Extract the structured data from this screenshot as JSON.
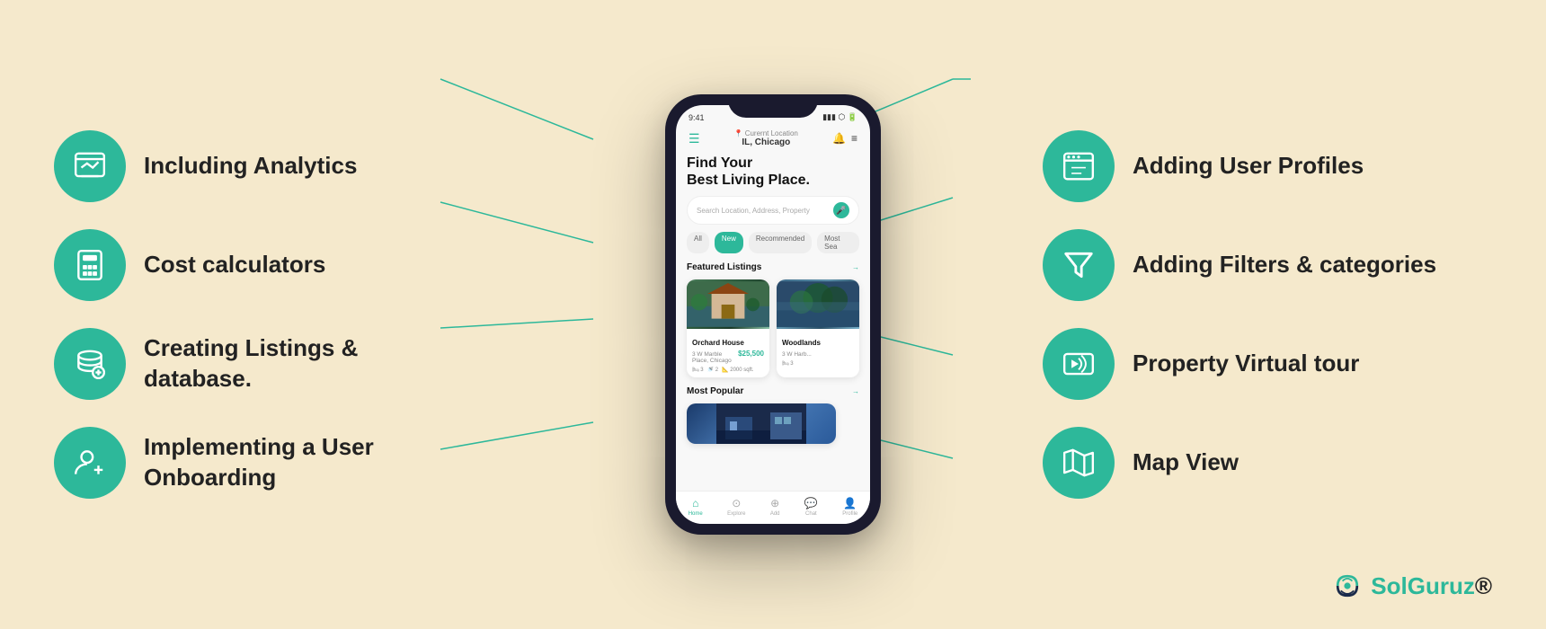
{
  "background_color": "#f5e9cc",
  "accent_color": "#2db89a",
  "left_features": [
    {
      "id": "analytics",
      "label": "Including Analytics",
      "icon": "analytics-icon"
    },
    {
      "id": "calculator",
      "label": "Cost calculators",
      "icon": "calculator-icon"
    },
    {
      "id": "listings",
      "label": "Creating Listings & database.",
      "icon": "database-icon"
    },
    {
      "id": "onboarding",
      "label": "Implementing a User Onboarding",
      "icon": "user-add-icon"
    }
  ],
  "right_features": [
    {
      "id": "profiles",
      "label": "Adding User Profiles",
      "icon": "profiles-icon"
    },
    {
      "id": "filters",
      "label": "Adding Filters & categories",
      "icon": "filter-icon"
    },
    {
      "id": "virtual-tour",
      "label": "Property Virtual tour",
      "icon": "virtual-tour-icon"
    },
    {
      "id": "map",
      "label": "Map View",
      "icon": "map-icon"
    }
  ],
  "phone": {
    "status_time": "9:41",
    "location_label": "Curernt Location",
    "location_city": "IL, Chicago",
    "app_title": "Find Your\nBest Living Place.",
    "search_placeholder": "Search Location, Address, Property",
    "filter_tabs": [
      "All",
      "New",
      "Recommended",
      "Most Sea"
    ],
    "active_tab": "New",
    "section_featured": "Featured Listings",
    "section_popular": "Most Popular",
    "listings": [
      {
        "name": "Orchard House",
        "price": "$25,500",
        "address": "3 W Marble Place, Chicago",
        "beds": 3,
        "baths": 2,
        "sqft": "2000 sqft."
      },
      {
        "name": "Woodlands",
        "address": "3 W Harb...",
        "beds": 3
      }
    ],
    "nav_items": [
      "Home",
      "Explore",
      "Add",
      "Chat",
      "Profile"
    ]
  },
  "logo": {
    "name": "SolGuruz",
    "registered": true
  }
}
